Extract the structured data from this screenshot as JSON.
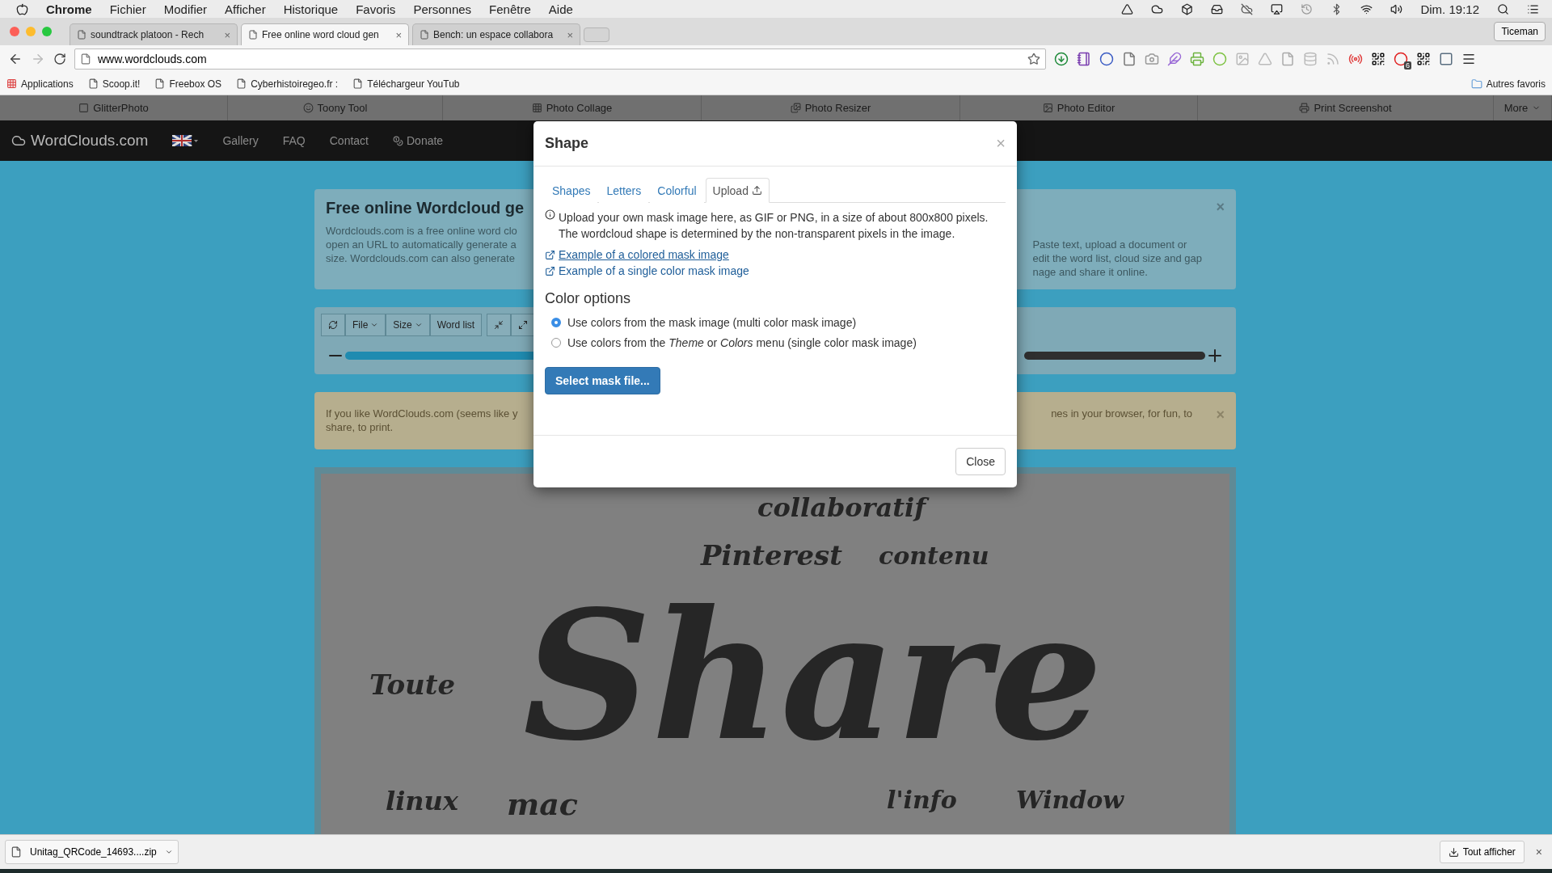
{
  "menu_bar": {
    "app": "Chrome",
    "items": [
      "Fichier",
      "Modifier",
      "Afficher",
      "Historique",
      "Favoris",
      "Personnes",
      "Fenêtre",
      "Aide"
    ],
    "clock": "Dim. 19:12"
  },
  "tabs": [
    {
      "title": "soundtrack platoon - Rech",
      "close": "×",
      "selected": false
    },
    {
      "title": "Free online word cloud gen",
      "close": "×",
      "selected": true
    },
    {
      "title": "Bench: un espace collabora",
      "close": "×",
      "selected": false
    }
  ],
  "profile": "Ticeman",
  "address": "www.wordclouds.com",
  "extension_badge": "6",
  "bookmarks": [
    "Applications",
    "Scoop.it!",
    "Freebox OS",
    "Cyberhistoiregeo.fr :",
    "Téléchargeur YouTub"
  ],
  "other_bookmarks": "Autres favoris",
  "toolbar_links": [
    "GlitterPhoto",
    "Toony Tool",
    "Photo Collage",
    "Photo Resizer",
    "Photo Editor",
    "Print Screenshot"
  ],
  "toolbar_more": "More",
  "site_nav": {
    "brand": "WordClouds.com",
    "items": [
      "Gallery",
      "FAQ",
      "Contact",
      "Donate"
    ]
  },
  "hero": {
    "title": "Free online Wordcloud ge",
    "close": "×",
    "left_lines": [
      "Wordclouds.com is a free online word clo",
      "open an URL to automatically generate a",
      "size. Wordclouds.com can also generate"
    ],
    "right_lines": [
      "Paste text, upload a document or",
      "edit the word list, cloud size and gap",
      "nage and share it online."
    ]
  },
  "tools": {
    "buttons": [
      "File",
      "Size",
      "Word list"
    ]
  },
  "notice": {
    "left_lines": [
      "If you like WordClouds.com (seems like y",
      "share, to print."
    ],
    "right_lines": [
      "nes in your browser, for fun, to"
    ],
    "close": "×"
  },
  "wordcloud": {
    "words": [
      {
        "text": "collaboratif",
        "kind": "word"
      },
      {
        "text": "Pinterest",
        "kind": "word"
      },
      {
        "text": "contenu",
        "kind": "word"
      },
      {
        "text": "Toute",
        "kind": "word"
      },
      {
        "text": "Share",
        "kind": "main"
      },
      {
        "text": "linux",
        "kind": "word"
      },
      {
        "text": "mac",
        "kind": "word"
      },
      {
        "text": "l'info",
        "kind": "word"
      },
      {
        "text": "Window",
        "kind": "word"
      }
    ]
  },
  "modal": {
    "title": "Shape",
    "close": "×",
    "tabs": [
      {
        "label": "Shapes",
        "selected": false
      },
      {
        "label": "Letters",
        "selected": false
      },
      {
        "label": "Colorful",
        "selected": false
      },
      {
        "label": "Upload",
        "selected": true
      }
    ],
    "info": "Upload your own mask image here, as GIF or PNG, in a size of about 800x800 pixels. The wordcloud shape is determined by the non-transparent pixels in the image.",
    "links": [
      {
        "text": "Example of a colored mask image",
        "underlined": true
      },
      {
        "text": "Example of a single color mask image",
        "underlined": false
      }
    ],
    "color_options_title": "Color options",
    "options": [
      {
        "label": "Use colors from the mask image (multi color mask image)",
        "selected": true
      },
      {
        "label": "Use colors from the *Theme* or *Colors* menu (single color mask image)",
        "selected": false
      }
    ],
    "select_button": "Select mask file...",
    "close_button": "Close"
  },
  "download": {
    "file": "Unitag_QRCode_14693....zip",
    "show_all": "Tout afficher",
    "close": "×"
  }
}
